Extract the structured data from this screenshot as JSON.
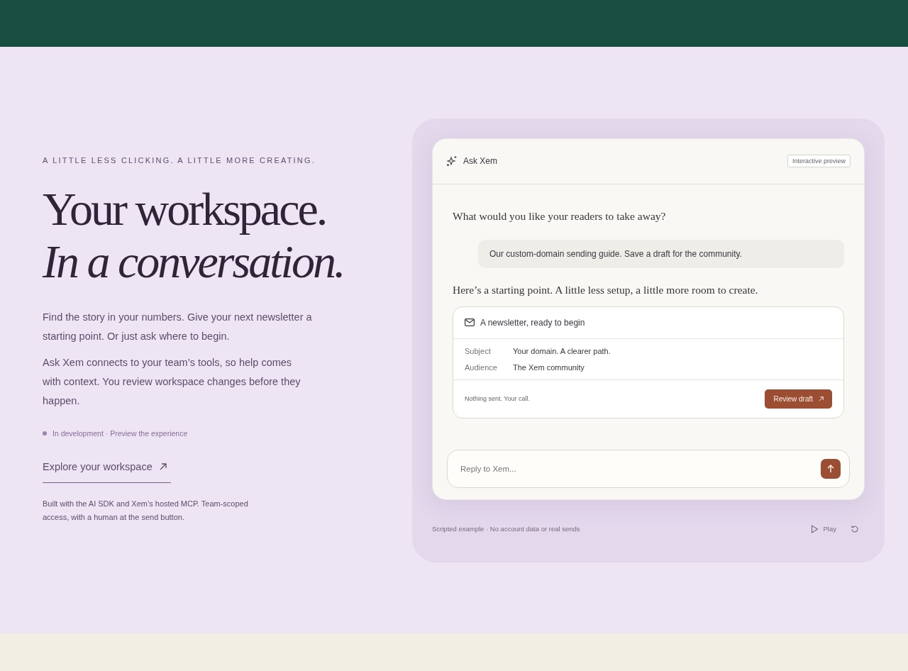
{
  "hero": {
    "eyebrow": "A LITTLE LESS CLICKING. A LITTLE MORE CREATING.",
    "title_line_1": "Your workspace.",
    "title_line_2": "In a conversation.",
    "paragraphs": [
      "Find the story in your numbers. Give your next newsletter a starting point. Or just ask where to begin.",
      "Ask Xem connects to your team’s tools, so help comes with context. You review workspace changes before they happen."
    ],
    "status": {
      "text": "In development · Preview the experience",
      "color": "#9a84a8"
    },
    "link": "Explore your workspace",
    "footnote": "Built with the AI SDK and Xem’s hosted MCP. Team-scoped access, with a human at the send button."
  },
  "chat": {
    "title": "Ask Xem",
    "badge": "Interactive preview",
    "messages": [
      {
        "kind": "assistant",
        "text": "What would you like your readers to take away?"
      },
      {
        "kind": "user",
        "text": "Our custom-domain sending guide. Save a draft for the community."
      },
      {
        "kind": "assistant",
        "text": "Here’s a starting point. A little less setup, a little more room to create."
      }
    ],
    "draft": {
      "title": "A newsletter, ready to begin",
      "fields": [
        {
          "label": "Subject",
          "value": "Your domain. A clearer path."
        },
        {
          "label": "Audience",
          "value": "The Xem community"
        }
      ],
      "note": "Nothing sent. Your call.",
      "button": "Review draft"
    },
    "reply": {
      "placeholder": "Reply to Xem..."
    },
    "caption": "Scripted example · No account data or real sends",
    "play": "Play"
  }
}
